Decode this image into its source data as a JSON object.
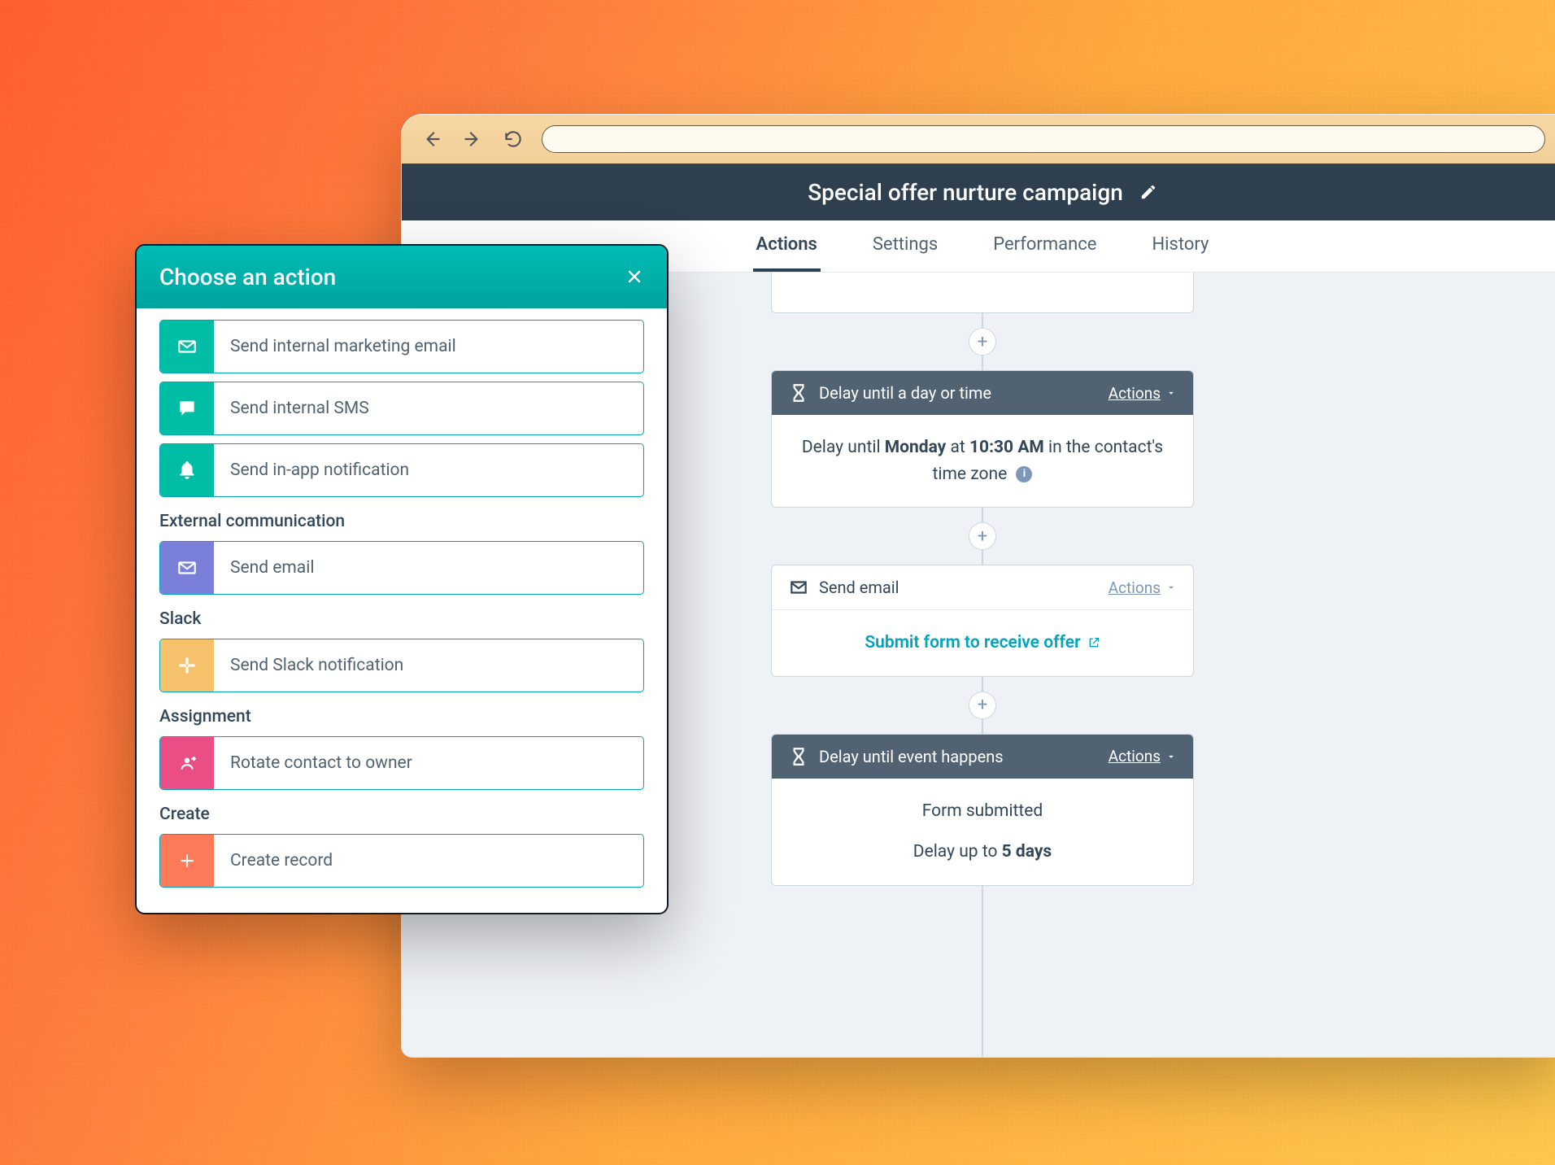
{
  "page": {
    "title": "Special offer nurture campaign",
    "tabs": [
      "Actions",
      "Settings",
      "Performance",
      "History"
    ],
    "active_tab": 0
  },
  "flow": {
    "delay1": {
      "header": "Delay until a day or time",
      "actions_label": "Actions",
      "body_prefix": "Delay until ",
      "day": "Monday",
      "at": " at ",
      "time": "10:30 AM",
      "suffix": " in the contact's time zone"
    },
    "email": {
      "header": "Send email",
      "actions_label": "Actions",
      "link": "Submit form to receive offer"
    },
    "delay2": {
      "header": "Delay until event happens",
      "actions_label": "Actions",
      "line1": "Form submitted",
      "line2_prefix": "Delay up to ",
      "line2_value": "5 days"
    }
  },
  "panel": {
    "title": "Choose an action",
    "sections": {
      "internal": {
        "items": [
          {
            "label": "Send internal marketing email"
          },
          {
            "label": "Send internal SMS"
          },
          {
            "label": "Send in-app notification"
          }
        ]
      },
      "external": {
        "title": "External communication",
        "items": [
          {
            "label": "Send email"
          }
        ]
      },
      "slack": {
        "title": "Slack",
        "items": [
          {
            "label": "Send Slack notification"
          }
        ]
      },
      "assignment": {
        "title": "Assignment",
        "items": [
          {
            "label": "Rotate contact to owner"
          }
        ]
      },
      "create": {
        "title": "Create",
        "items": [
          {
            "label": "Create record"
          }
        ]
      }
    }
  }
}
